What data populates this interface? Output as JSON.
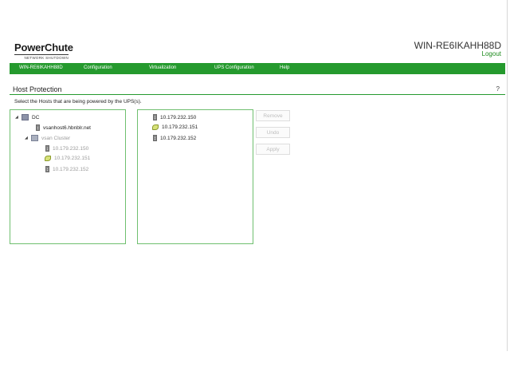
{
  "header": {
    "logo_main": "PowerChute",
    "logo_sub": "NETWORK SHUTDOWN",
    "hostname": "WIN-RE6IKAHH88D",
    "logout": "Logout"
  },
  "nav": {
    "items": [
      {
        "label": "WIN-RE6IKAHH88D"
      },
      {
        "label": "Configuration"
      },
      {
        "label": "Virtualization"
      },
      {
        "label": "UPS Configuration"
      },
      {
        "label": "Help"
      }
    ]
  },
  "page": {
    "title": "Host Protection",
    "help": "?",
    "instruction": "Select the Hosts that are being powered by the UPS(s)."
  },
  "left_tree": {
    "dc": {
      "toggle": "◢",
      "label": "DC"
    },
    "host": {
      "label": "vsanhost6.hbnblr.net"
    },
    "cluster": {
      "toggle": "◢",
      "label": "vsan Cluster"
    },
    "children": [
      {
        "label": "10.179.232.150"
      },
      {
        "label": "10.179.232.151"
      },
      {
        "label": "10.179.232.152"
      }
    ]
  },
  "right_list": {
    "items": [
      {
        "label": "10.179.232.150"
      },
      {
        "label": "10.179.232.151"
      },
      {
        "label": "10.179.232.152"
      }
    ]
  },
  "buttons": {
    "remove": "Remove",
    "undo": "Undo",
    "apply": "Apply"
  },
  "colors": {
    "brand_green": "#259a2e",
    "panel_border": "#6fbf6f",
    "link_green": "#1c8a1c"
  }
}
